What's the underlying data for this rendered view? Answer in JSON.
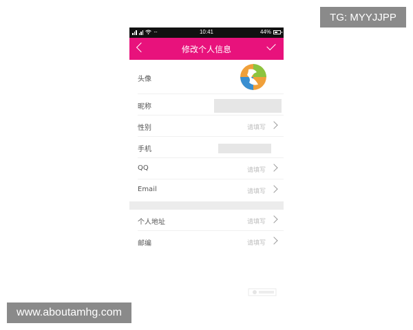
{
  "overlay": {
    "tg_label": "TG: MYYJJPP",
    "site_label": "www.aboutamhg.com"
  },
  "statusbar": {
    "time": "10:41",
    "battery": "44%"
  },
  "header": {
    "title": "修改个人信息"
  },
  "rows": [
    {
      "label": "头像"
    },
    {
      "label": "昵称"
    },
    {
      "label": "性别",
      "hint": "请填写"
    },
    {
      "label": "手机"
    },
    {
      "label": "QQ",
      "hint": "请填写"
    },
    {
      "label": "Email",
      "hint": "请填写"
    },
    {
      "label": "个人地址",
      "hint": "请填写"
    },
    {
      "label": "邮编",
      "hint": "请填写"
    }
  ],
  "colors": {
    "accent": "#e8127c",
    "statusbar": "#111111",
    "divider": "#ececec"
  }
}
